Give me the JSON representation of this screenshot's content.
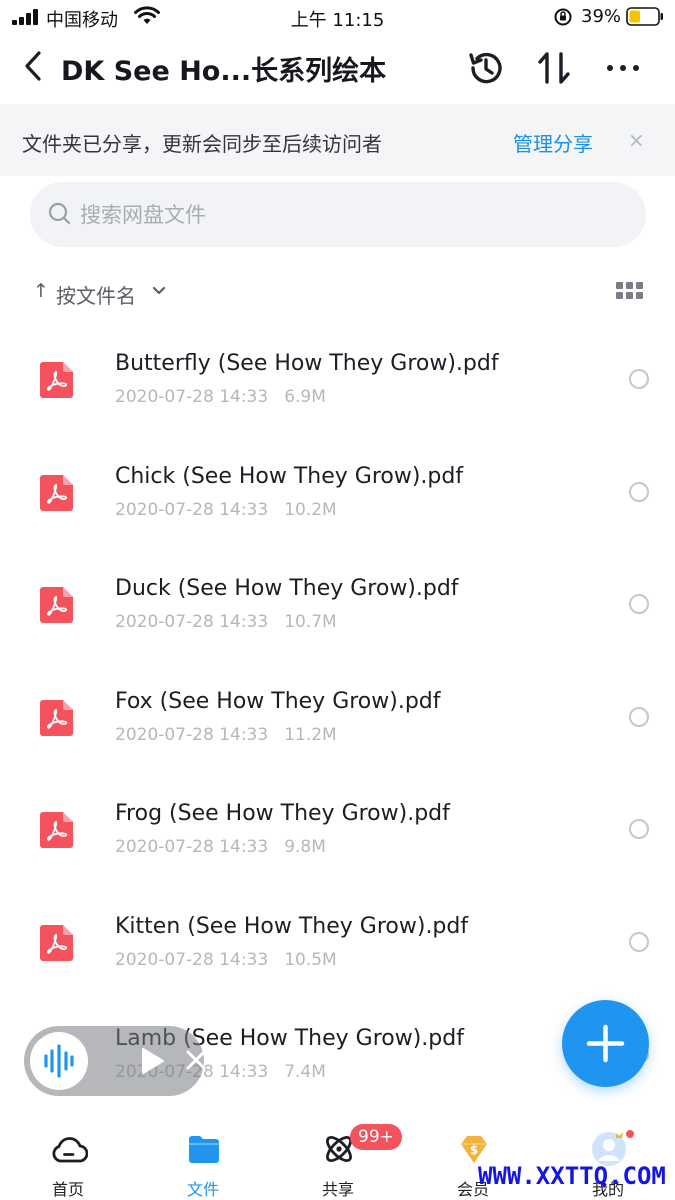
{
  "status_bar": {
    "carrier": "中国移动",
    "time": "上午 11:15",
    "battery_percent": "39%",
    "battery_level": 0.39
  },
  "nav": {
    "title": "DK See Ho...长系列绘本",
    "icons": [
      "back-icon",
      "history-icon",
      "sort-icon",
      "more-icon"
    ]
  },
  "share_banner": {
    "text": "文件夹已分享，更新会同步至后续访问者",
    "manage_label": "管理分享",
    "close_glyph": "×"
  },
  "search": {
    "placeholder": "搜索网盘文件",
    "value": ""
  },
  "sort": {
    "arrow": "↑",
    "label": "按文件名"
  },
  "files": [
    {
      "name": "Butterfly (See How They Grow).pdf",
      "date": "2020-07-28 14:33",
      "size": "6.9M"
    },
    {
      "name": "Chick (See How They Grow).pdf",
      "date": "2020-07-28 14:33",
      "size": "10.2M"
    },
    {
      "name": "Duck (See How They Grow).pdf",
      "date": "2020-07-28 14:33",
      "size": "10.7M"
    },
    {
      "name": "Fox (See How They Grow).pdf",
      "date": "2020-07-28 14:33",
      "size": "11.2M"
    },
    {
      "name": "Frog (See How They Grow).pdf",
      "date": "2020-07-28 14:33",
      "size": "9.8M"
    },
    {
      "name": "Kitten (See How They Grow).pdf",
      "date": "2020-07-28 14:33",
      "size": "10.5M"
    },
    {
      "name": "Lamb (See How They Grow).pdf",
      "date": "2020-07-28 14:33",
      "size": "7.4M"
    }
  ],
  "tabs": [
    {
      "label": "首页",
      "icon": "cloud-icon"
    },
    {
      "label": "文件",
      "icon": "folder-icon",
      "active": true
    },
    {
      "label": "共享",
      "icon": "atom-icon"
    },
    {
      "label": "会员",
      "icon": "vip-diamond-icon"
    },
    {
      "label": "我的",
      "icon": "avatar-icon"
    }
  ],
  "badges": {
    "share_count": "99+"
  },
  "watermark": "WWW.XXTTQ.COM",
  "colors": {
    "accent": "#1f95f0",
    "pdf_red": "#f4535d",
    "badge_red": "#f4535d",
    "banner_bg": "#f4f5f7"
  }
}
